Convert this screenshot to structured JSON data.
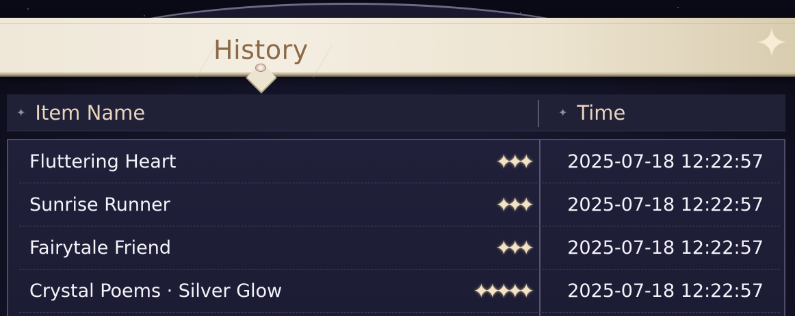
{
  "window": {
    "title": "History"
  },
  "table": {
    "columns": [
      {
        "label": "Item Name"
      },
      {
        "label": "Time"
      }
    ],
    "rows": [
      {
        "name": "Fluttering Heart",
        "stars": "✦✦✦",
        "rating": 3,
        "time": "2025-07-18 12:22:57"
      },
      {
        "name": "Sunrise Runner",
        "stars": "✦✦✦",
        "rating": 3,
        "time": "2025-07-18 12:22:57"
      },
      {
        "name": "Fairytale Friend",
        "stars": "✦✦✦",
        "rating": 3,
        "time": "2025-07-18 12:22:57"
      },
      {
        "name": "Crystal Poems · Silver Glow",
        "stars": "✦✦✦✦✦",
        "rating": 5,
        "time": "2025-07-18 12:22:57"
      }
    ]
  },
  "icons": {
    "header_mark": "four-point-star-icon",
    "corner": "sparkle-star-icon",
    "rating": "star-icon"
  },
  "colors": {
    "title": "#8c6a48",
    "header_text": "#ead5be",
    "row_text": "#f5f3fa",
    "star": "#f3e3c6"
  }
}
